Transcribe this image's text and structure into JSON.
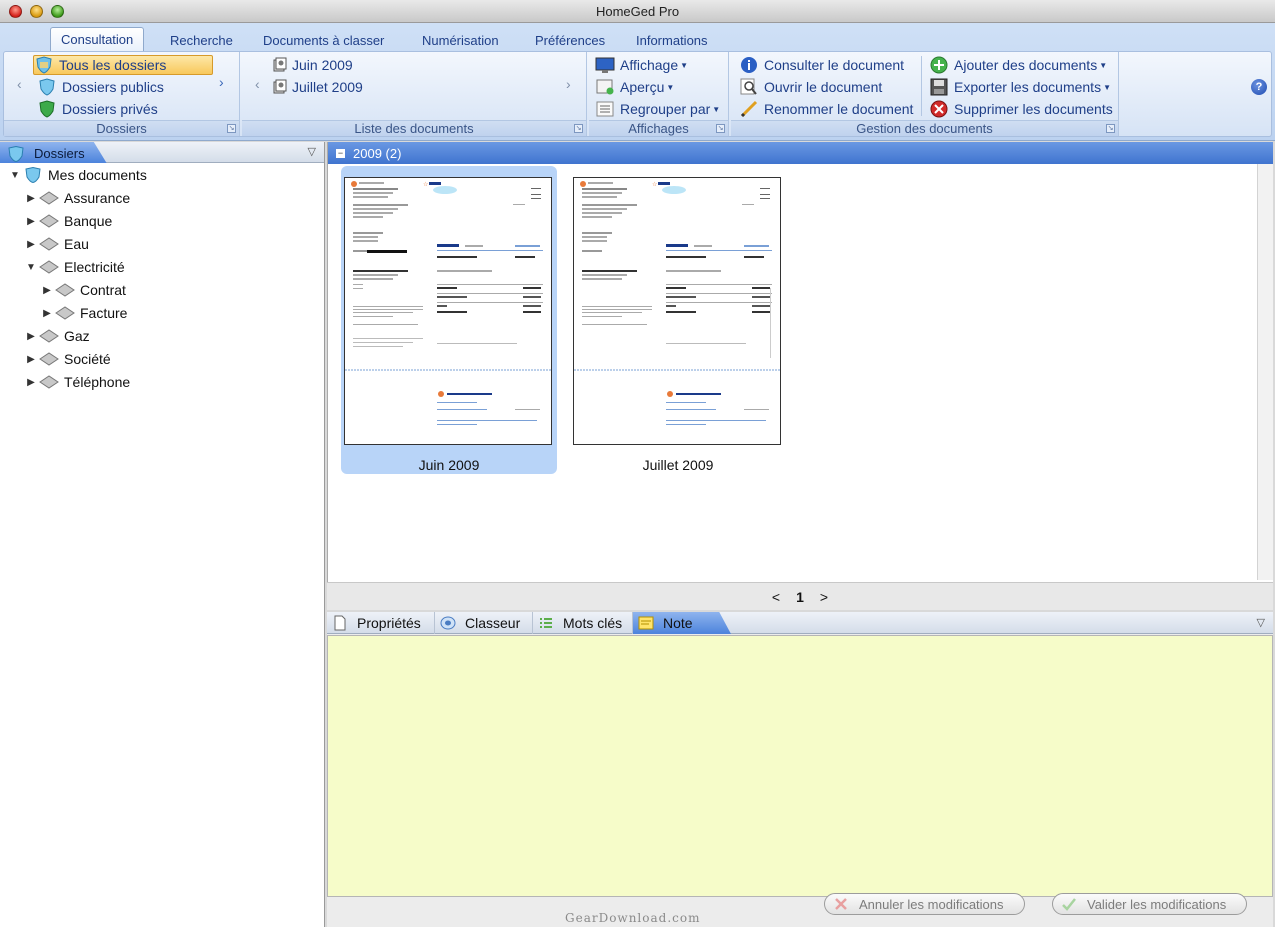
{
  "window": {
    "title": "HomeGed Pro"
  },
  "ribbon": {
    "tabs": [
      "Consultation",
      "Recherche",
      "Documents à classer",
      "Numérisation",
      "Préférences",
      "Informations"
    ],
    "groups": {
      "dossiers": {
        "label": "Dossiers",
        "items": [
          "Tous les dossiers",
          "Dossiers publics",
          "Dossiers privés"
        ]
      },
      "liste": {
        "label": "Liste des documents",
        "items": [
          "Juin 2009",
          "Juillet 2009"
        ]
      },
      "affichages": {
        "label": "Affichages",
        "items": [
          "Affichage",
          "Aperçu",
          "Regrouper par"
        ]
      },
      "gestion": {
        "label": "Gestion des documents",
        "col1": [
          "Consulter le document",
          "Ouvrir le document",
          "Renommer le document"
        ],
        "col2": [
          "Ajouter des documents",
          "Exporter les documents",
          "Supprimer les documents"
        ]
      }
    },
    "help_icon": "?"
  },
  "left_panel": {
    "title": "Dossiers",
    "tree": {
      "root": "Mes documents",
      "items": [
        "Assurance",
        "Banque",
        "Eau",
        "Electricité",
        "Contrat",
        "Facture",
        "Gaz",
        "Société",
        "Téléphone"
      ]
    }
  },
  "documents": {
    "group_header": "2009 (2)",
    "thumbnails": [
      "Juin 2009",
      "Juillet 2009"
    ],
    "pager": {
      "prev": "<",
      "current": "1",
      "next": ">"
    }
  },
  "bottom_panel": {
    "tabs": [
      "Propriétés",
      "Classeur",
      "Mots clés",
      "Note"
    ],
    "active_tab": "Note",
    "buttons": {
      "cancel": "Annuler les modifications",
      "validate": "Valider les modifications"
    }
  },
  "watermark": "GearDownload.com",
  "colors": {
    "accent": "#4c83dc",
    "note_bg": "#f6fcc9",
    "ribbon_text": "#1f3f88"
  }
}
